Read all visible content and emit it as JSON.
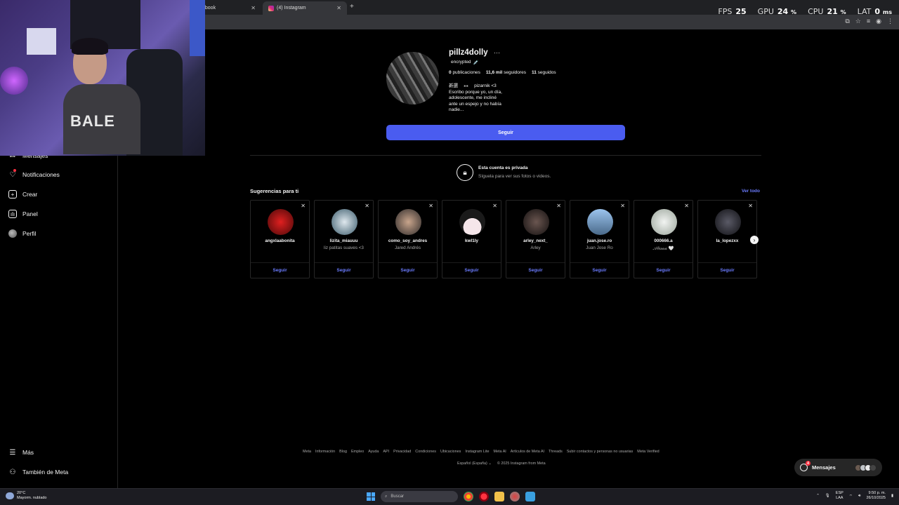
{
  "browser": {
    "tabs": [
      {
        "label": "ebook",
        "active": false
      },
      {
        "label": "(4) Instagram",
        "active": true
      }
    ],
    "new_tab_symbol": "+"
  },
  "overlay_stats": {
    "fps_label": "FPS",
    "fps_value": "25",
    "gpu_label": "GPU",
    "gpu_value": "24",
    "gpu_unit": "%",
    "cpu_label": "CPU",
    "cpu_value": "21",
    "cpu_unit": "%",
    "lat_label": "LAT",
    "lat_value": "0",
    "lat_unit": "ms"
  },
  "webcam": {
    "shirt_text": "BALE"
  },
  "sidebar": {
    "items": [
      {
        "label": "Mensajes",
        "icon": "messenger-icon"
      },
      {
        "label": "Notificaciones",
        "icon": "heart-icon"
      },
      {
        "label": "Crear",
        "icon": "plus-square-icon"
      },
      {
        "label": "Panel",
        "icon": "chart-icon"
      },
      {
        "label": "Perfil",
        "icon": "avatar"
      }
    ],
    "bottom_items": [
      {
        "label": "Más",
        "icon": "hamburger-icon"
      },
      {
        "label": "También de Meta",
        "icon": "meta-icon"
      }
    ]
  },
  "profile": {
    "username": "pillz4dolly",
    "more": "···",
    "subtitle": "encrypted",
    "subtitle_emoji": "💉",
    "stats": [
      {
        "value": "0",
        "label": "publicaciones"
      },
      {
        "value": "11,6 mil",
        "label": "seguidores"
      },
      {
        "value": "11",
        "label": "seguidos"
      }
    ],
    "bio_line1": "新選 　⁎⁎ 　pizarnik <3",
    "bio_line2": "Escribo porque yo, un día, adolescente, me incliné ante un espejo y no había nadie...",
    "follow_label": "Seguir"
  },
  "private_notice": {
    "title": "Esta cuenta es privada",
    "subtitle": "Síguela para ver sus fotos o videos."
  },
  "suggestions": {
    "title": "Sugerencias para ti",
    "see_all": "Ver todo",
    "follow_label": "Seguir",
    "cards": [
      {
        "username": "angxlaabonita",
        "name": "",
        "color": "#b01818"
      },
      {
        "username": "lizita_miauuu",
        "name": "liz patitas suaves <3",
        "color": "#8aa7b8"
      },
      {
        "username": "como_soy_andres",
        "name": "Jared Andrés",
        "color": "#6b5a4a"
      },
      {
        "username": "kwl1ly",
        "name": "",
        "color": "#e7cfd6"
      },
      {
        "username": "arley_next_",
        "name": "Arley",
        "color": "#3a2e2e"
      },
      {
        "username": "juan.jose.ro",
        "name": "Juan Jose Ro",
        "color": "#6f94c0"
      },
      {
        "username": "000666.a",
        "name": "𝒜𝓁𝑒𝓍𝒶𝒶 🤍",
        "color": "#d8dcd8"
      },
      {
        "username": "la_lopezxx",
        "name": "",
        "color": "#2b2b33"
      }
    ]
  },
  "footer": {
    "links": [
      "Meta",
      "Información",
      "Blog",
      "Empleo",
      "Ayuda",
      "API",
      "Privacidad",
      "Condiciones",
      "Ubicaciones",
      "Instagram Lite",
      "Meta AI",
      "Artículos de Meta AI",
      "Threads",
      "Subir contactos y personas no usuarias",
      "Meta Verified"
    ],
    "language": "Español (España)",
    "copyright": "© 2025 Instagram from Meta"
  },
  "messages_pill": {
    "label": "Mensajes",
    "badge": "4"
  },
  "taskbar": {
    "weather_temp": "20°C",
    "weather_desc": "Mayorm. nublado",
    "search_placeholder": "Buscar",
    "lang_top": "ESP",
    "lang_bottom": "LAA",
    "time": "9:50 p. m.",
    "date": "26/10/2025"
  }
}
